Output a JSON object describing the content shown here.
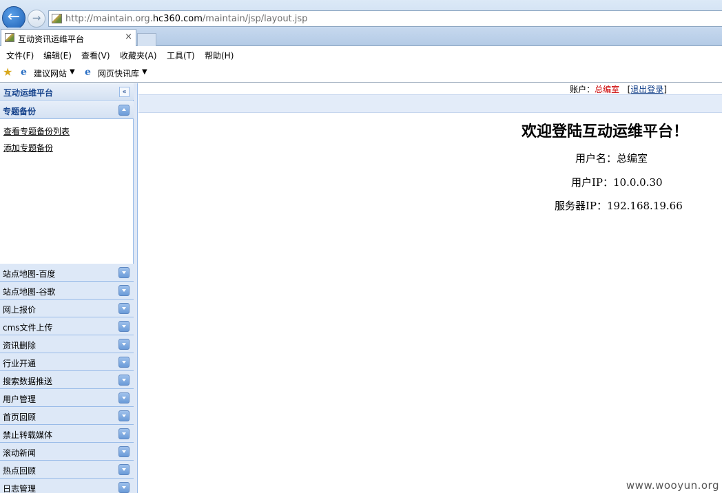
{
  "browser": {
    "url_prefix": "http://maintain.org.",
    "url_domain": "hc360.com",
    "url_path": "/maintain/jsp/layout.jsp",
    "tab_title": "互动资讯运维平台",
    "tab_close": "×"
  },
  "menu": [
    "文件(F)",
    "编辑(E)",
    "查看(V)",
    "收藏夹(A)",
    "工具(T)",
    "帮助(H)"
  ],
  "favorites": {
    "items": [
      "建议网站",
      "网页快讯库"
    ]
  },
  "sidebar": {
    "title": "互动运维平台",
    "collapse_glyph": "«",
    "open_panel": {
      "title": "专题备份",
      "links": [
        "查看专题备份列表",
        "添加专题备份"
      ]
    },
    "panels": [
      "站点地图-百度",
      "站点地图-谷歌",
      "网上报价",
      "cms文件上传",
      "资讯删除",
      "行业开通",
      "搜索数据推送",
      "用户管理",
      "首页回顾",
      "禁止转载媒体",
      "滚动新闻",
      "热点回顾",
      "日志管理"
    ]
  },
  "main": {
    "account_label": "账户：",
    "account_name": "总编室",
    "logout_prefix": "[",
    "logout_label": "退出登录",
    "logout_suffix": "]",
    "welcome": "欢迎登陆互动运维平台！",
    "username_line": "用户名：总编室",
    "user_ip_line": "用户IP：10.0.0.30",
    "server_ip_line": "服务器IP：192.168.19.66"
  },
  "watermark": "www.wooyun.org"
}
